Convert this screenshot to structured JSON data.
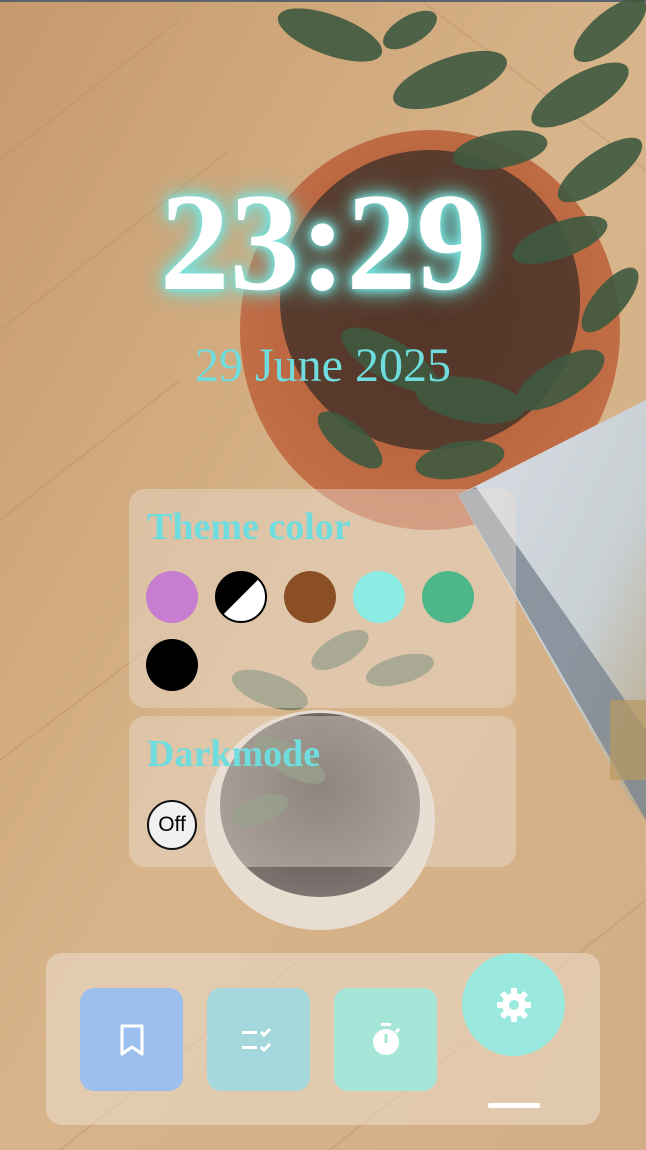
{
  "clock": {
    "time": "23:29",
    "date": "29 June 2025"
  },
  "theme": {
    "title": "Theme color",
    "swatches": [
      {
        "name": "purple",
        "color": "#c77dd0"
      },
      {
        "name": "black-white",
        "color": "#000000/#ffffff"
      },
      {
        "name": "brown",
        "color": "#8b4f25"
      },
      {
        "name": "cyan",
        "color": "#8aece2"
      },
      {
        "name": "green",
        "color": "#4db68a"
      },
      {
        "name": "black",
        "color": "#000000"
      }
    ]
  },
  "darkmode": {
    "title": "Darkmode",
    "toggle_label": "Off"
  },
  "dock": {
    "items": [
      {
        "icon": "bookmark-icon",
        "color": "#9cbfee"
      },
      {
        "icon": "checklist-icon",
        "color": "#a4d8dd"
      },
      {
        "icon": "stopwatch-icon",
        "color": "#a5e6d9"
      },
      {
        "icon": "gear-icon",
        "color": "#9ae8de",
        "active": true
      }
    ]
  }
}
